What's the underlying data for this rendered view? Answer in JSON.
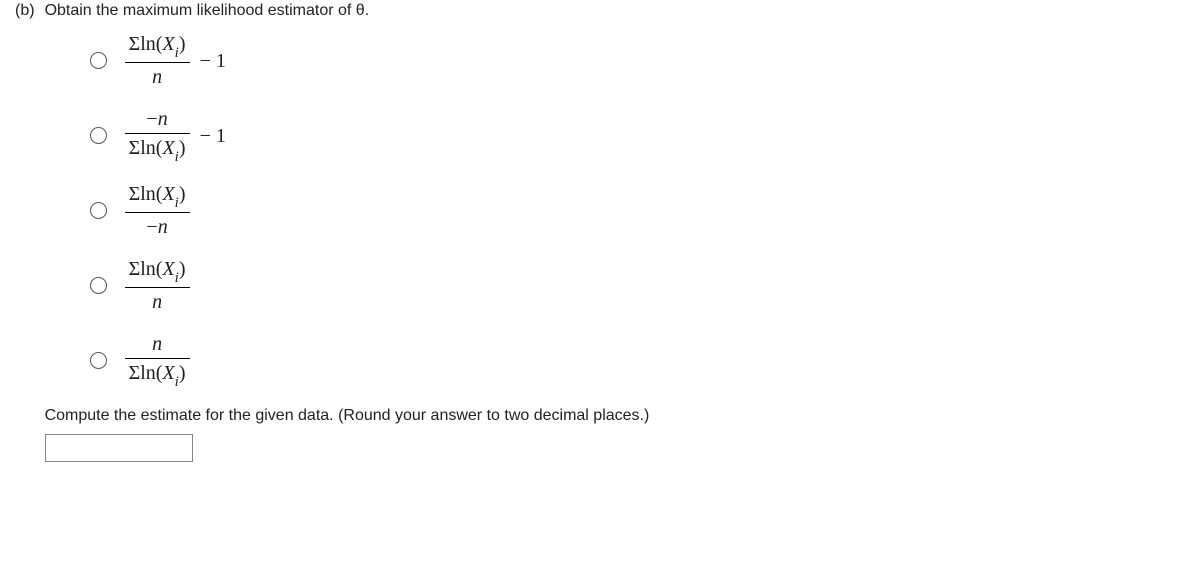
{
  "part": {
    "label": "(b)",
    "question": "Obtain the maximum likelihood estimator of θ."
  },
  "options": [
    {
      "numerator": "Σln(X<sub>i</sub>)",
      "denominator": "n",
      "tail": "− 1",
      "narrow": false
    },
    {
      "numerator": "−n",
      "denominator": "Σln(X<sub>i</sub>)",
      "tail": "− 1",
      "narrow": false
    },
    {
      "numerator": "Σln(X<sub>i</sub>)",
      "denominator": "−n",
      "tail": "",
      "narrow": false
    },
    {
      "numerator": "Σln(X<sub>i</sub>)",
      "denominator": "n",
      "tail": "",
      "narrow": false
    },
    {
      "numerator": "n",
      "denominator": "Σln(X<sub>i</sub>)",
      "tail": "",
      "narrow": false
    }
  ],
  "instruction": "Compute the estimate for the given data. (Round your answer to two decimal places.)",
  "answer_placeholder": ""
}
